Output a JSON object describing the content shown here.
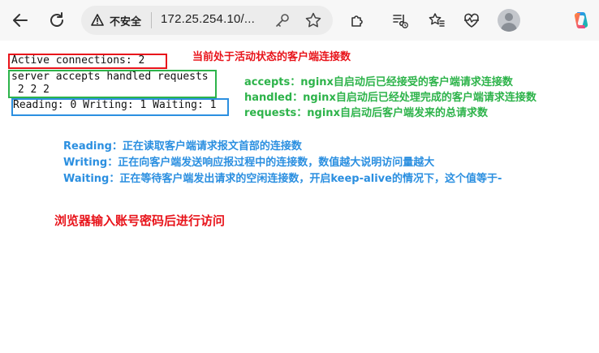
{
  "browser": {
    "security_label": "不安全",
    "url": "172.25.254.10/...",
    "icons": [
      "back-icon",
      "refresh-icon",
      "warning-icon",
      "key-icon",
      "star-icon",
      "extensions-icon",
      "media-icon",
      "favorites-icon",
      "health-icon",
      "profile-avatar",
      "copilot-icon"
    ]
  },
  "status": {
    "line1": "Active connections: 2",
    "line2": "server accepts handled requests",
    "line3": " 2 2 2",
    "line4": "Reading: 0 Writing: 1 Waiting: 1"
  },
  "annotations": {
    "active_note": "当前处于活动状态的客户端连接数",
    "accepts_note": "accepts：nginx自启动后已经接受的客户端请求连接数",
    "handled_note": "handled：nginx自启动后已经处理完成的客户端请求连接数",
    "requests_note": "requests：nginx自启动后客户端发来的总请求数",
    "reading_note": "Reading：正在读取客户端请求报文首部的连接数",
    "writing_note": "Writing：正在向客户端发送响应报过程中的连接数，数值越大说明访问量越大",
    "waiting_note": "Waiting：正在等待客户端发出请求的空闲连接数，开启keep-alive的情况下，这个值等于-",
    "access_note": "浏览器输入账号密码后进行访问"
  },
  "colors": {
    "red": "#e8141b",
    "green": "#2db34a",
    "blue": "#2b8fe0",
    "toolbar_bg": "#f7f7f7"
  }
}
